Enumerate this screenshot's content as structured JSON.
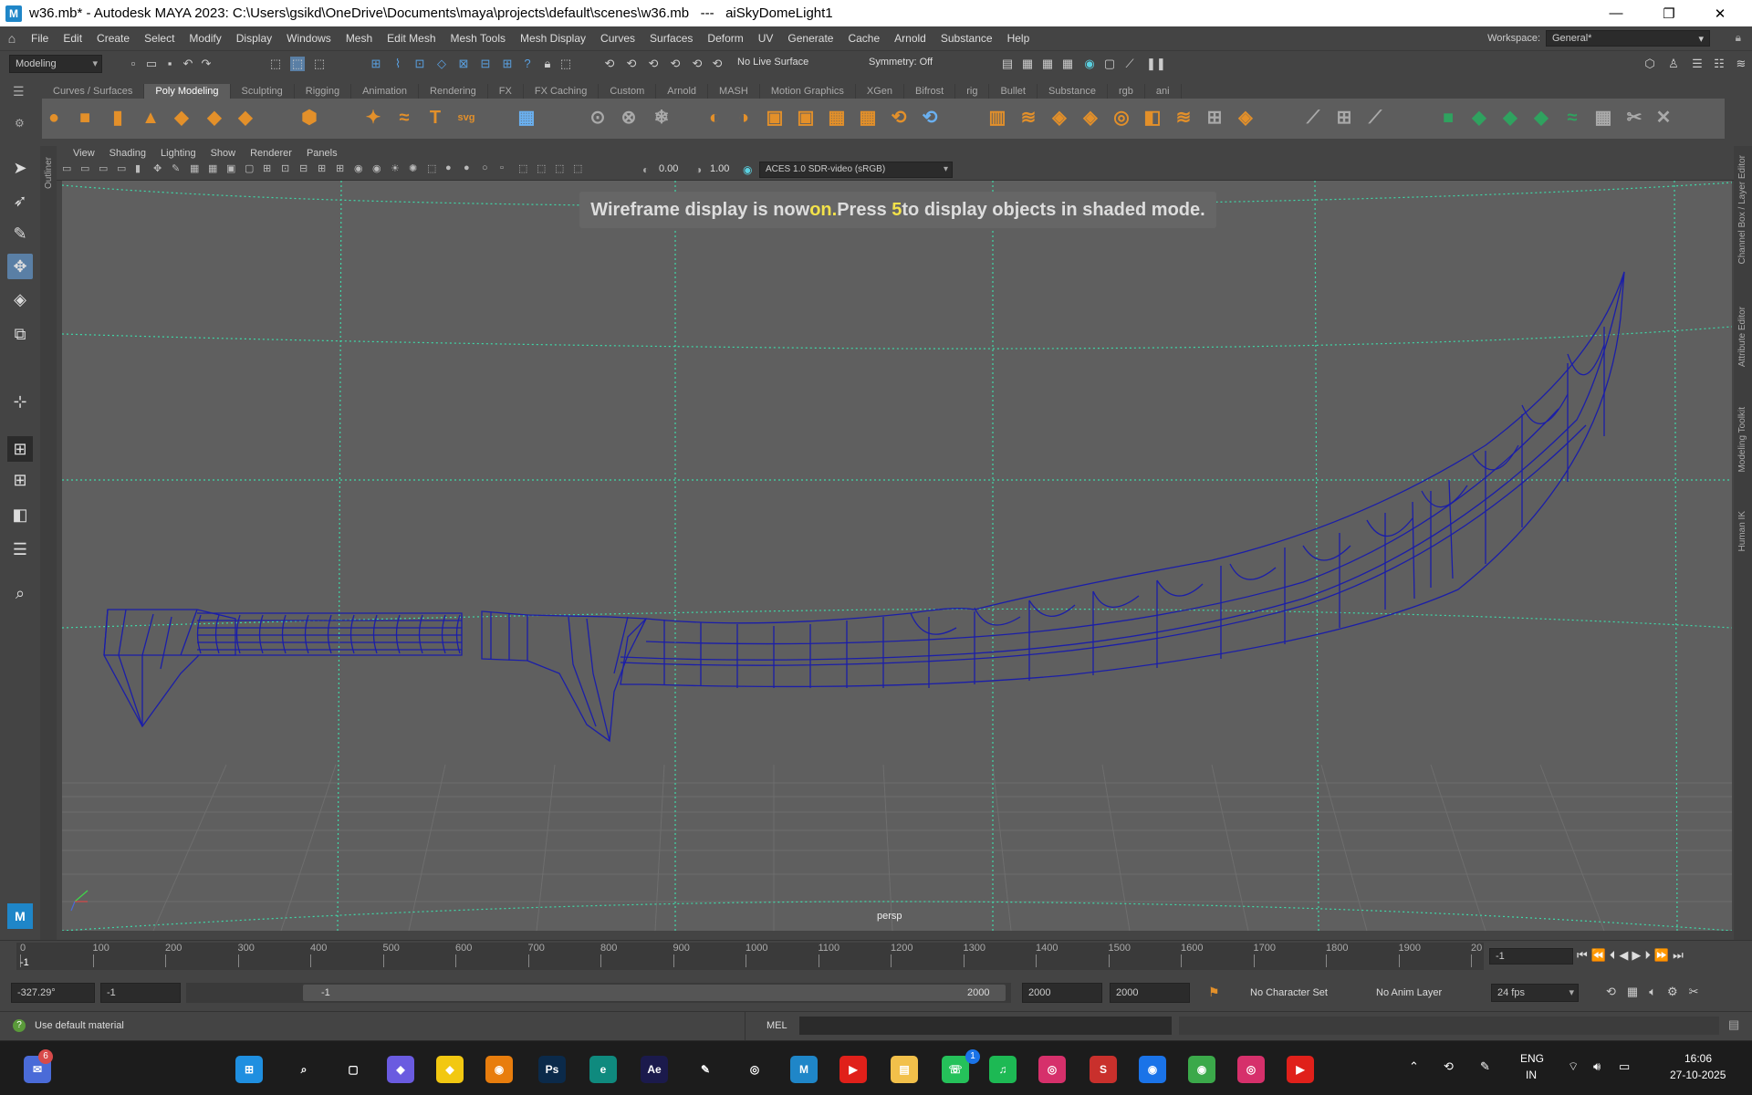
{
  "window": {
    "title": "w36.mb* - Autodesk MAYA 2023: C:\\Users\\gsikd\\OneDrive\\Documents\\maya\\projects\\default\\scenes\\w36.mb   ---   aiSkyDomeLight1",
    "minimize": "—",
    "maximize": "❐",
    "close": "✕"
  },
  "menu": [
    "File",
    "Edit",
    "Create",
    "Select",
    "Modify",
    "Display",
    "Windows",
    "Mesh",
    "Edit Mesh",
    "Mesh Tools",
    "Mesh Display",
    "Curves",
    "Surfaces",
    "Deform",
    "UV",
    "Generate",
    "Cache",
    "Arnold",
    "Substance",
    "Help"
  ],
  "workspace": {
    "label": "Workspace:",
    "value": "General*"
  },
  "status_line": {
    "mode": "Modeling",
    "live_surface": "No Live Surface",
    "symmetry": "Symmetry: Off"
  },
  "shelf_tabs": [
    "Curves / Surfaces",
    "Poly Modeling",
    "Sculpting",
    "Rigging",
    "Animation",
    "Rendering",
    "FX",
    "FX Caching",
    "Custom",
    "Arnold",
    "MASH",
    "Motion Graphics",
    "XGen",
    "Bifrost",
    "rig",
    "Bullet",
    "Substance",
    "rgb",
    "ani"
  ],
  "shelf_active": "Poly Modeling",
  "shelf_text_icons": {
    "type": "T",
    "svg": "svg"
  },
  "panel_menu": [
    "View",
    "Shading",
    "Lighting",
    "Show",
    "Renderer",
    "Panels"
  ],
  "panel_toolbar": {
    "exposure": "0.00",
    "gamma": "1.00",
    "color_space": "ACES 1.0 SDR-video (sRGB)"
  },
  "side_labels": {
    "outliner": "Outliner",
    "channel_box": "Channel Box / Layer Editor",
    "attribute_editor": "Attribute Editor",
    "modeling_toolkit": "Modeling Toolkit",
    "human_ik": "Human IK"
  },
  "hud": {
    "pre": "Wireframe display is now ",
    "on": "on.",
    "mid": "Press ",
    "key": "5",
    "post": " to display objects in shaded mode."
  },
  "viewport": {
    "camera": "persp"
  },
  "timeline": {
    "ticks": [
      "0",
      "100",
      "200",
      "300",
      "400",
      "500",
      "600",
      "700",
      "800",
      "900",
      "1000",
      "1100",
      "1200",
      "1300",
      "1400",
      "1500",
      "1600",
      "1700",
      "1800",
      "1900",
      "20"
    ],
    "current_frame_marker": "-1",
    "current_frame_field": "-1"
  },
  "range": {
    "coord": "-327.29°",
    "start": "-1",
    "range_start": "-1",
    "range_end": "2000",
    "end": "2000",
    "end2": "2000",
    "character_set": "No Character Set",
    "anim_layer": "No Anim Layer",
    "fps": "24 fps"
  },
  "help_line": {
    "message": "Use default material",
    "cmd_type": "MEL"
  },
  "taskbar": {
    "notification_badge": "6",
    "whatsapp_badge": "1",
    "lang1": "ENG",
    "lang2": "IN",
    "time": "16:06",
    "date": "27-10-2025",
    "apps": [
      {
        "name": "windows-start-icon",
        "label": "⊞",
        "color": "#1f8fe0"
      },
      {
        "name": "search-icon",
        "label": "⌕",
        "color": "transparent"
      },
      {
        "name": "task-view-icon",
        "label": "▢",
        "color": "transparent"
      },
      {
        "name": "copilot-icon",
        "label": "◆",
        "color": "#6a5be0"
      },
      {
        "name": "sticky-icon",
        "label": "◆",
        "color": "#f2c811"
      },
      {
        "name": "blender-icon",
        "label": "◉",
        "color": "#e87d0d"
      },
      {
        "name": "photoshop-icon",
        "label": "Ps",
        "color": "#0b2a4a"
      },
      {
        "name": "edge-icon",
        "label": "e",
        "color": "#0f8a7e"
      },
      {
        "name": "after-effects-icon",
        "label": "Ae",
        "color": "#1b1a4c"
      },
      {
        "name": "pen-icon",
        "label": "✎",
        "color": "transparent"
      },
      {
        "name": "obs-icon",
        "label": "◎",
        "color": "transparent"
      },
      {
        "name": "maya-icon",
        "label": "M",
        "color": "#1f86c8"
      },
      {
        "name": "youtube-icon",
        "label": "▶",
        "color": "#e0201a"
      },
      {
        "name": "explorer-icon",
        "label": "▤",
        "color": "#f2c04a"
      },
      {
        "name": "whatsapp-icon",
        "label": "☏",
        "color": "#25c15a"
      },
      {
        "name": "spotify-icon",
        "label": "♫",
        "color": "#1db954"
      },
      {
        "name": "instagram-icon",
        "label": "◎",
        "color": "#d6306b"
      },
      {
        "name": "substance-icon",
        "label": "S",
        "color": "#c9302c"
      },
      {
        "name": "maps-icon",
        "label": "◉",
        "color": "#1a73e8"
      },
      {
        "name": "chrome-icon",
        "label": "◉",
        "color": "#3ba94a"
      },
      {
        "name": "instagram2-icon",
        "label": "◎",
        "color": "#d6306b"
      },
      {
        "name": "youtube2-icon",
        "label": "▶",
        "color": "#e0201a"
      }
    ]
  },
  "colors": {
    "wire": "#1b1ea8",
    "accent": "#5a7fa5",
    "shelf_green": "#2fa25f",
    "shelf_orange": "#e3902a"
  }
}
